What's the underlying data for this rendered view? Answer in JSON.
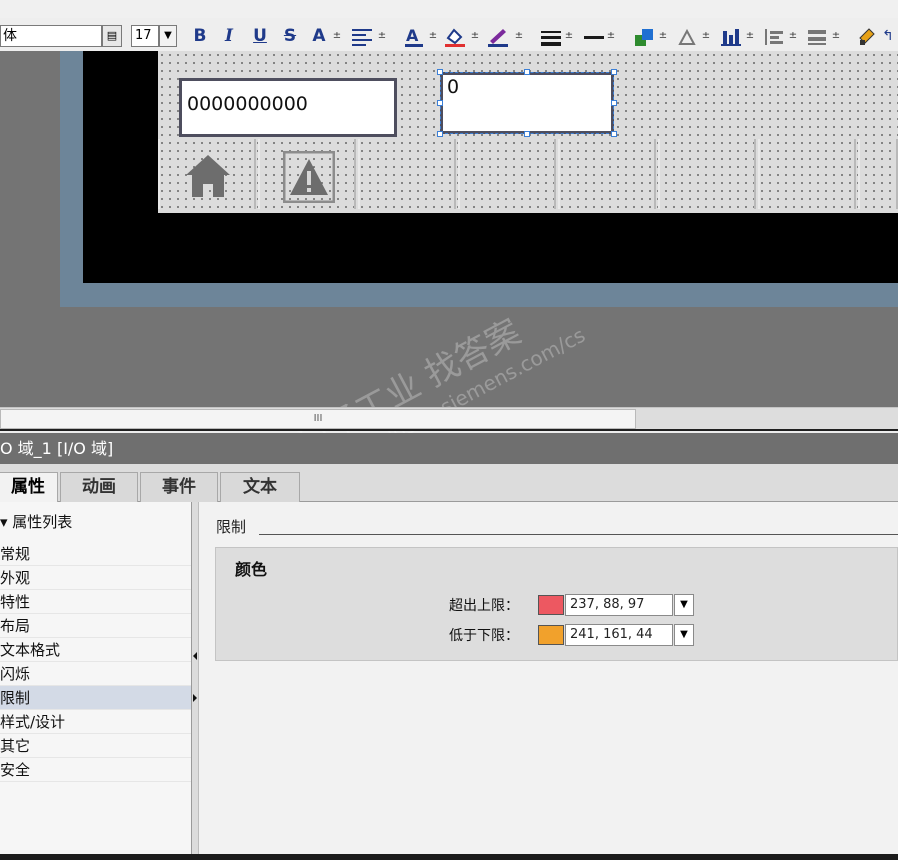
{
  "toolbar": {
    "font_name": "体",
    "font_size": "17",
    "bold_label": "B",
    "italic_label": "I",
    "underline_label": "U",
    "strike_label": "S",
    "textsize_label": "A"
  },
  "canvas": {
    "io_field_a_value": "0000000000",
    "io_field_b_value": "0",
    "hscroll_grip": "III"
  },
  "inspector": {
    "title": "O 域_1 [I/O 域]",
    "tabs": [
      "属性",
      "动画",
      "事件",
      "文本"
    ],
    "active_tab": "属性",
    "tree_header": "▾ 属性列表",
    "tree_items": [
      "常规",
      "外观",
      "特性",
      "布局",
      "文本格式",
      "闪烁",
      "限制",
      "样式/设计",
      "其它",
      "安全"
    ],
    "selected_item": "限制",
    "section_title": "限制",
    "group_title": "颜色",
    "limits": [
      {
        "label": "超出上限：",
        "value": "237, 88, 97",
        "color": "#ED5861"
      },
      {
        "label": "低于下限：",
        "value": "241, 161, 44",
        "color": "#F1A12C"
      }
    ]
  },
  "watermark": {
    "line1": "西门子工业  找答案",
    "line2": "support.industry.siemens.com/cs"
  }
}
